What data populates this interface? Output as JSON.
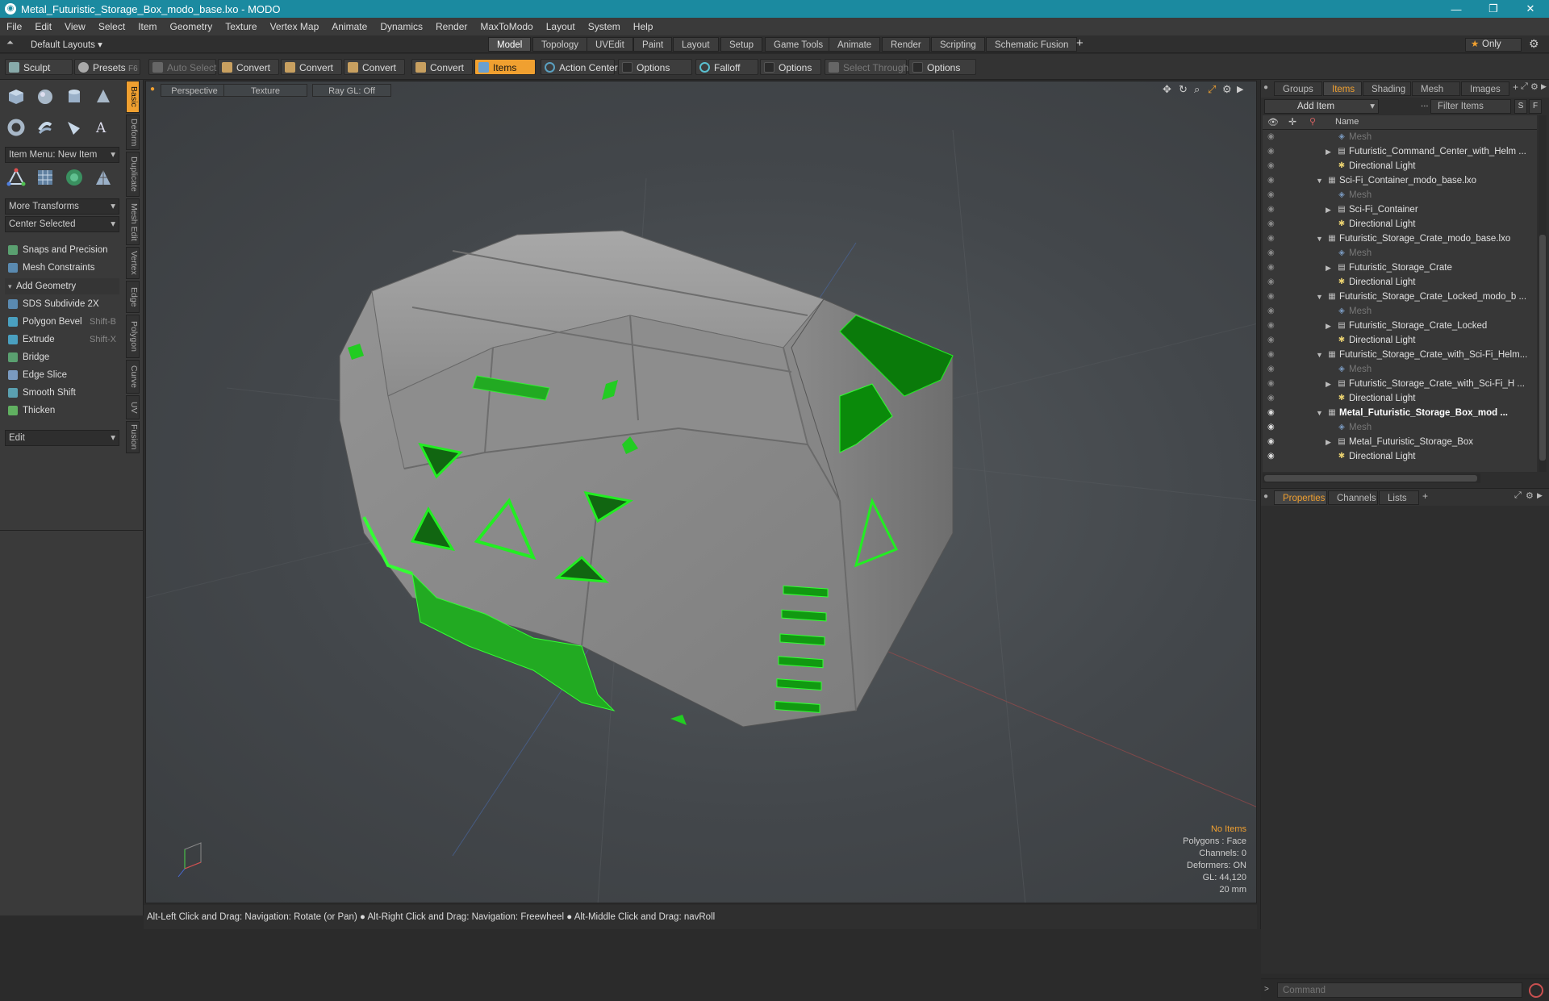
{
  "window": {
    "title": "Metal_Futuristic_Storage_Box_modo_base.lxo - MODO",
    "min": "—",
    "max": "❐",
    "close": "✕"
  },
  "menu": [
    "File",
    "Edit",
    "View",
    "Select",
    "Item",
    "Geometry",
    "Texture",
    "Vertex Map",
    "Animate",
    "Dynamics",
    "Render",
    "MaxToModo",
    "Layout",
    "System",
    "Help"
  ],
  "layouts": {
    "label": "Default Layouts ▾",
    "only": "Only"
  },
  "tabs": [
    "Model",
    "Topology",
    "UVEdit",
    "Paint",
    "Layout",
    "Setup",
    "Game Tools",
    "Animate",
    "Render",
    "Scripting",
    "Schematic Fusion"
  ],
  "toolbar": {
    "sculpt": "Sculpt",
    "presets": "Presets",
    "presets_key": "F6",
    "auto_select": "Auto Select",
    "convert1": "Convert",
    "convert2": "Convert",
    "convert3": "Convert",
    "convert4": "Convert",
    "items": "Items",
    "action_center": "Action Center",
    "options1": "Options",
    "falloff": "Falloff",
    "options2": "Options",
    "select_through": "Select Through",
    "options3": "Options"
  },
  "vtabs": [
    "Basic",
    "Deform",
    "Duplicate",
    "Mesh Edit",
    "Vertex",
    "Edge",
    "Polygon",
    "Curve",
    "UV",
    "Fusion"
  ],
  "left": {
    "item_menu": "Item Menu: New Item",
    "more_transforms": "More Transforms",
    "center_selected": "Center Selected",
    "snaps": "Snaps and Precision",
    "mesh_constraints": "Mesh Constraints",
    "add_geometry": "Add Geometry",
    "tools": [
      {
        "label": "SDS Subdivide 2X",
        "key": "",
        "color": "#5a8ab0"
      },
      {
        "label": "Polygon Bevel",
        "key": "Shift-B",
        "color": "#4aa0c0"
      },
      {
        "label": "Extrude",
        "key": "Shift-X",
        "color": "#4aa0c0"
      },
      {
        "label": "Bridge",
        "key": "",
        "color": "#5aa070"
      },
      {
        "label": "Edge Slice",
        "key": "",
        "color": "#7a9ac0"
      },
      {
        "label": "Smooth Shift",
        "key": "",
        "color": "#5aa0b0"
      },
      {
        "label": "Thicken",
        "key": "",
        "color": "#60b060"
      }
    ],
    "edit": "Edit"
  },
  "viewport": {
    "perspective": "Perspective",
    "texture": "Texture",
    "raygl": "Ray GL: Off"
  },
  "hud": {
    "line1": "No Items",
    "line2": "Polygons : Face",
    "line3": "Channels: 0",
    "line4": "Deformers: ON",
    "line5": "GL: 44,120",
    "line6": "20 mm"
  },
  "status": "Alt-Left Click and Drag: Navigation: Rotate (or Pan) ● Alt-Right Click and Drag: Navigation: Freewheel ● Alt-Middle Click and Drag: navRoll",
  "right": {
    "tabs": [
      "Groups",
      "Items",
      "Shading",
      "Mesh ...",
      "Images"
    ],
    "add_item": "Add Item",
    "filter": "Filter Items",
    "s": "S",
    "f": "F",
    "col_name": "Name",
    "tree": [
      {
        "label": "Mesh",
        "indent": 2,
        "type": "mesh",
        "dim": true
      },
      {
        "label": "Futuristic_Command_Center_with_Helm ...",
        "indent": 2,
        "type": "item",
        "arrow": "▶"
      },
      {
        "label": "Directional Light",
        "indent": 2,
        "type": "light"
      },
      {
        "label": "Sci-Fi_Container_modo_base.lxo",
        "indent": 1,
        "type": "scene",
        "arrow": "▼"
      },
      {
        "label": "Mesh",
        "indent": 2,
        "type": "mesh",
        "dim": true
      },
      {
        "label": "Sci-Fi_Container",
        "indent": 2,
        "type": "item",
        "arrow": "▶"
      },
      {
        "label": "Directional Light",
        "indent": 2,
        "type": "light"
      },
      {
        "label": "Futuristic_Storage_Crate_modo_base.lxo",
        "indent": 1,
        "type": "scene",
        "arrow": "▼"
      },
      {
        "label": "Mesh",
        "indent": 2,
        "type": "mesh",
        "dim": true
      },
      {
        "label": "Futuristic_Storage_Crate",
        "indent": 2,
        "type": "item",
        "arrow": "▶"
      },
      {
        "label": "Directional Light",
        "indent": 2,
        "type": "light"
      },
      {
        "label": "Futuristic_Storage_Crate_Locked_modo_b ...",
        "indent": 1,
        "type": "scene",
        "arrow": "▼"
      },
      {
        "label": "Mesh",
        "indent": 2,
        "type": "mesh",
        "dim": true
      },
      {
        "label": "Futuristic_Storage_Crate_Locked",
        "indent": 2,
        "type": "item",
        "arrow": "▶"
      },
      {
        "label": "Directional Light",
        "indent": 2,
        "type": "light"
      },
      {
        "label": "Futuristic_Storage_Crate_with_Sci-Fi_Helm...",
        "indent": 1,
        "type": "scene",
        "arrow": "▼"
      },
      {
        "label": "Mesh",
        "indent": 2,
        "type": "mesh",
        "dim": true
      },
      {
        "label": "Futuristic_Storage_Crate_with_Sci-Fi_H ...",
        "indent": 2,
        "type": "item",
        "arrow": "▶"
      },
      {
        "label": "Directional Light",
        "indent": 2,
        "type": "light"
      },
      {
        "label": "Metal_Futuristic_Storage_Box_mod ...",
        "indent": 1,
        "type": "scene",
        "arrow": "▼",
        "bold": true
      },
      {
        "label": "Mesh",
        "indent": 2,
        "type": "mesh",
        "dim": true
      },
      {
        "label": "Metal_Futuristic_Storage_Box",
        "indent": 2,
        "type": "item",
        "arrow": "▶"
      },
      {
        "label": "Directional Light",
        "indent": 2,
        "type": "light"
      }
    ],
    "props_tabs": [
      "Properties",
      "Channels",
      "Lists"
    ],
    "command_placeholder": "Command"
  },
  "colors": {
    "accent": "#f0a030",
    "green": "#22dd22",
    "titlebar": "#1b8aa0"
  }
}
